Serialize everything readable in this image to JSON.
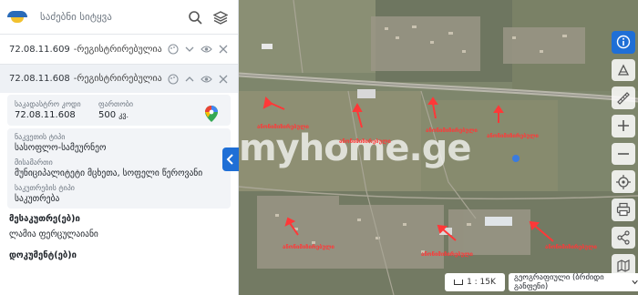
{
  "search": {
    "placeholder": "საძებნი სიტყვა"
  },
  "parcels": [
    {
      "code": "72.08.11.609",
      "status": "-რეგისტრირებულია"
    },
    {
      "code": "72.08.11.608",
      "status": "-რეგისტრირებულია"
    }
  ],
  "details": {
    "cadastral_label": "საკადასტრო კოდი",
    "cadastral_value": "72.08.11.608",
    "area_label": "ფართობი",
    "area_value": "500",
    "area_unit": "კვ.",
    "land_type_label": "ნაკვეთის ტიპი",
    "land_type_value": "სასოფლო-სამეურნეო",
    "address_label": "მისამართი",
    "address_value": "მუნიციპალიტეტი მცხეთა, სოფელი წეროვანი",
    "ownership_label": "საკუთრების ტიპი",
    "ownership_value": "საკუთრება"
  },
  "owners": {
    "heading": "მესაკუთრე(ებ)ი",
    "value": "ლამია ფერცულაიანი"
  },
  "documents": {
    "heading": "დოკუმენტ(ებ)ი"
  },
  "map": {
    "watermark": "myhome.ge",
    "arrow_label": "ანონიმიზირებული",
    "scale": "1 : 15K",
    "layer": "გეოგრაფიული (ბრძიდი განფენი)"
  },
  "colors": {
    "accent": "#1f6fd6",
    "arrow": "#ff3838",
    "panel_bg": "#f2f4f7"
  }
}
